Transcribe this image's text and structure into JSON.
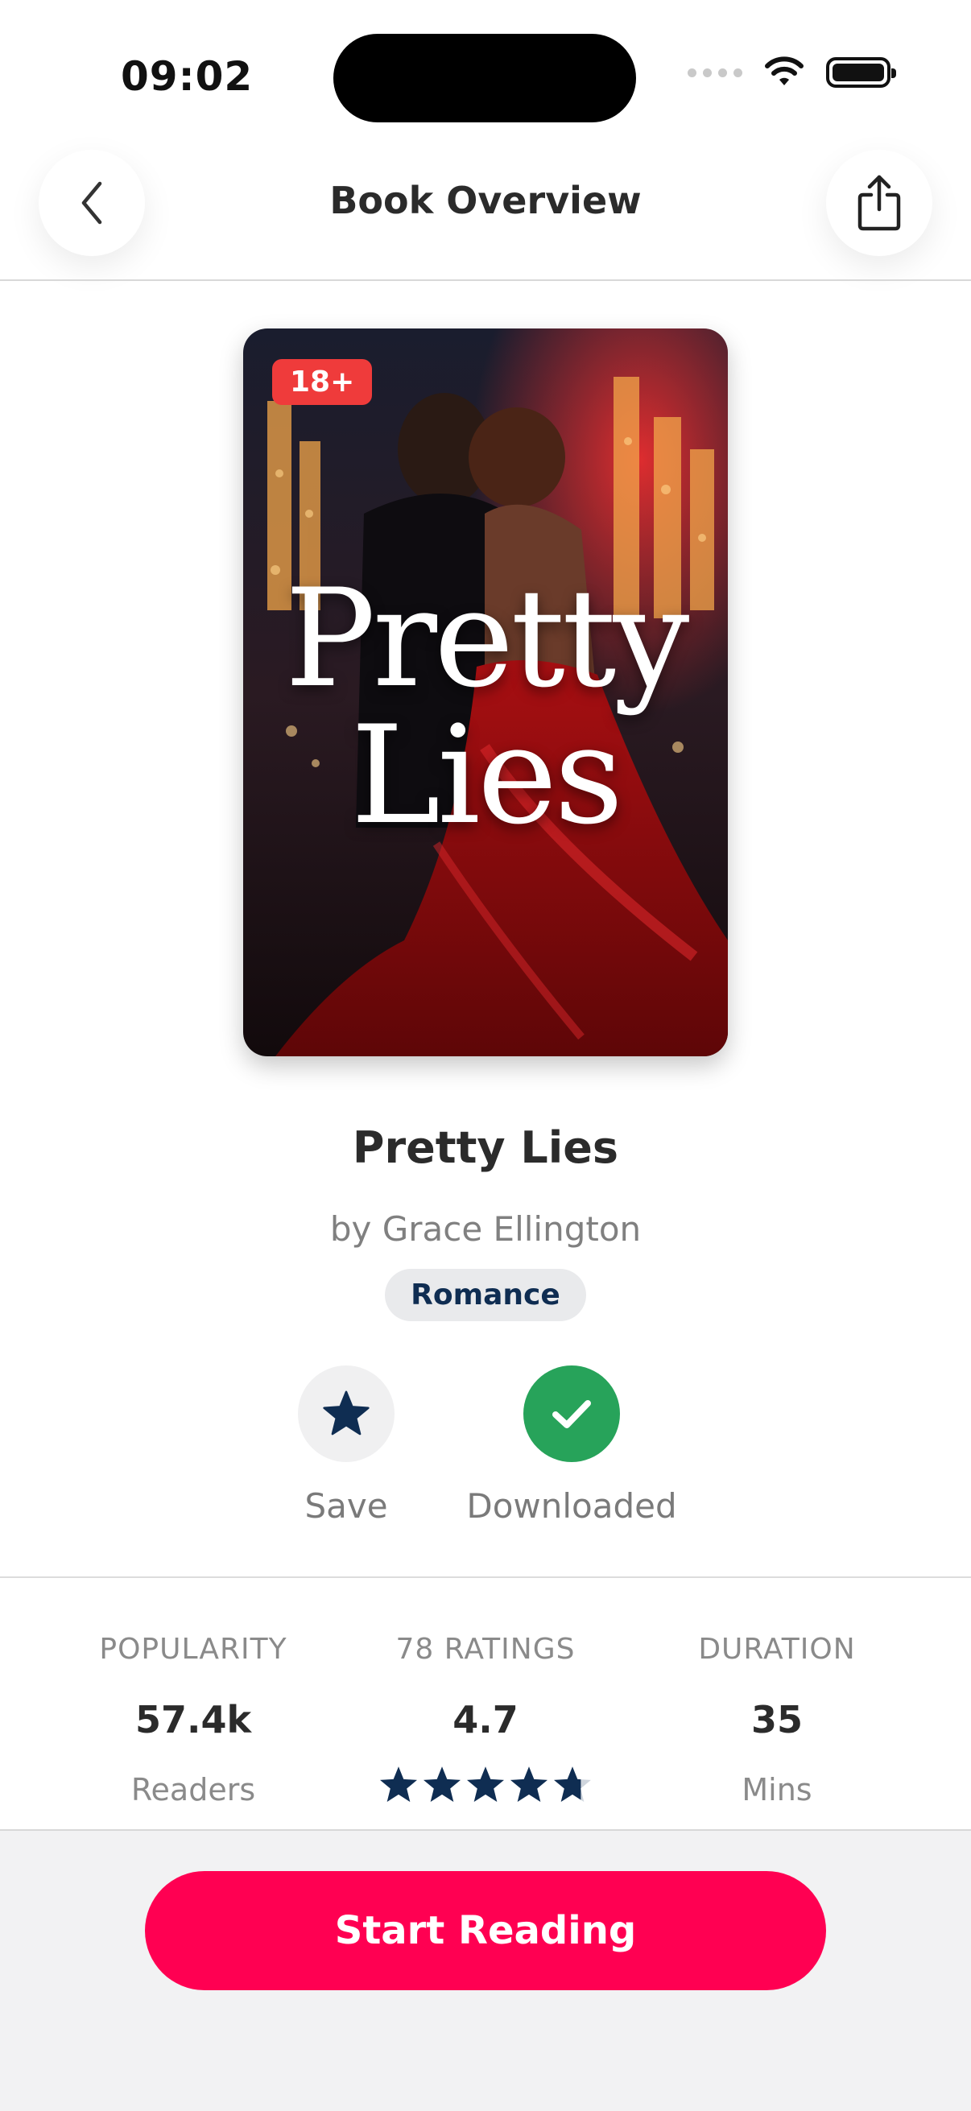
{
  "status_bar": {
    "time": "09:02"
  },
  "header": {
    "title": "Book Overview"
  },
  "book": {
    "cover_title_line1": "Pretty",
    "cover_title_line2": "Lies",
    "age_rating": "18+",
    "title": "Pretty Lies",
    "author": "by Grace Ellington",
    "genre": "Romance"
  },
  "actions": {
    "save_label": "Save",
    "downloaded_label": "Downloaded"
  },
  "stats": {
    "popularity": {
      "label": "POPULARITY",
      "value": "57.4k",
      "unit": "Readers"
    },
    "ratings": {
      "label": "78 RATINGS",
      "value": "4.7",
      "stars": 4.7,
      "max_stars": 5
    },
    "duration": {
      "label": "DURATION",
      "value": "35",
      "unit": "Mins"
    }
  },
  "cta": {
    "label": "Start Reading"
  },
  "colors": {
    "accent": "#ff0052",
    "download_green": "#27a35a",
    "star_navy": "#0f2d52",
    "age_badge": "#ef3b3b"
  }
}
